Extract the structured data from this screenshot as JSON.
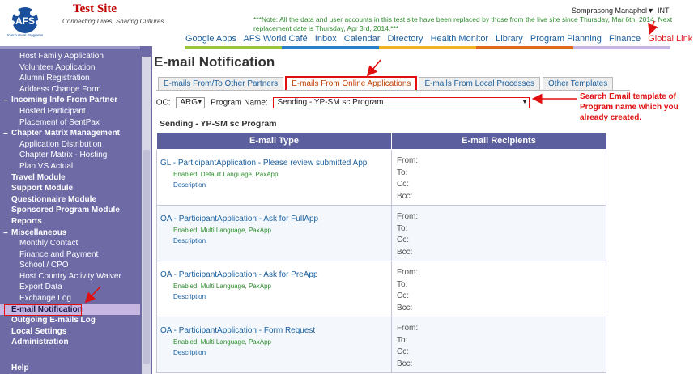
{
  "header": {
    "logo_text": "AFS",
    "logo_subtext": "Intercultural Programs",
    "site_title": "Test Site",
    "tagline": "Connecting Lives, Sharing Cultures",
    "user_name": "Somprasong Manaphol▼",
    "user_region": "INT",
    "notice": "***Note: All the data and user accounts in this test site have been replaced by those from the live site since Thursday, Mar 6th, 2014. Next replacement date is Thursday, Apr 3rd, 2014.***"
  },
  "topnav": [
    "Google Apps",
    "AFS World Café",
    "Inbox",
    "Calendar",
    "Directory",
    "Health Monitor",
    "Library",
    "Program Planning",
    "Finance",
    "Global Link",
    "Lo"
  ],
  "colors": {
    "sidebar_bg": "#6d6aa6",
    "table_header": "#5b5f9e",
    "link_blue": "#1a5f9e",
    "annotation_red": "#e01010",
    "meta_green": "#2e8b2e",
    "colorbar": [
      "#9bc53d",
      "#2b7fc4",
      "#f0b323",
      "#e06a1a",
      "#c8b6e2"
    ]
  },
  "sidebar": {
    "items": [
      {
        "label": "Host Family Application",
        "type": "sub"
      },
      {
        "label": "Volunteer Application",
        "type": "sub"
      },
      {
        "label": "Alumni Registration",
        "type": "sub"
      },
      {
        "label": "Address Change Form",
        "type": "sub"
      },
      {
        "label": "Incoming Info From Partner",
        "type": "head",
        "expand": "−"
      },
      {
        "label": "Hosted Participant",
        "type": "sub"
      },
      {
        "label": "Placement of SentPax",
        "type": "sub"
      },
      {
        "label": "Chapter Matrix Management",
        "type": "head",
        "expand": "−"
      },
      {
        "label": "Application Distribution",
        "type": "sub"
      },
      {
        "label": "Chapter Matrix - Hosting",
        "type": "sub"
      },
      {
        "label": "Plan VS Actual",
        "type": "sub"
      },
      {
        "label": "Travel Module",
        "type": "head"
      },
      {
        "label": "Support Module",
        "type": "head"
      },
      {
        "label": "Questionnaire Module",
        "type": "head"
      },
      {
        "label": "Sponsored Program Module",
        "type": "head"
      },
      {
        "label": "Reports",
        "type": "head"
      },
      {
        "label": "Miscellaneous",
        "type": "head",
        "expand": "−"
      },
      {
        "label": "Monthly Contact",
        "type": "sub"
      },
      {
        "label": "Finance and Payment",
        "type": "sub"
      },
      {
        "label": "School / CPO",
        "type": "sub"
      },
      {
        "label": "Host Country Activity Waiver",
        "type": "sub"
      },
      {
        "label": "Export Data",
        "type": "sub"
      },
      {
        "label": "Exchange Log",
        "type": "sub"
      },
      {
        "label": "E-mail Notification",
        "type": "head",
        "active": true
      },
      {
        "label": "Outgoing E-mails Log",
        "type": "head"
      },
      {
        "label": "Local Settings",
        "type": "head"
      },
      {
        "label": "Administration",
        "type": "head"
      }
    ],
    "help": "Help"
  },
  "main": {
    "title": "E-mail Notification",
    "tabs": [
      {
        "label": "E-mails From/To Other Partners",
        "active": false
      },
      {
        "label": "E-mails From Online Applications",
        "active": true
      },
      {
        "label": "E-mails From Local Processes",
        "active": false
      },
      {
        "label": "Other Templates",
        "active": false
      }
    ],
    "filter": {
      "ioc_label": "IOC:",
      "ioc_value": "ARG",
      "program_label": "Program Name:",
      "program_value": "Sending - YP-SM sc Program"
    },
    "annotation": "Search Email template of Program name which you already created.",
    "program_heading": "Sending - YP-SM sc Program",
    "table": {
      "headers": [
        "E-mail Type",
        "E-mail Recipients"
      ],
      "recipient_labels": [
        "From:",
        "To:",
        "Cc:",
        "Bcc:"
      ],
      "rows": [
        {
          "name": "GL - ParticipantApplication - Please review submitted App",
          "meta": "Enabled, Default Language, PaxApp",
          "desc": "Description"
        },
        {
          "name": "OA - ParticipantApplication - Ask for FullApp",
          "meta": "Enabled, Multi Language, PaxApp",
          "desc": "Description"
        },
        {
          "name": "OA - ParticipantApplication - Ask for PreApp",
          "meta": "Enabled, Multi Language, PaxApp",
          "desc": "Description"
        },
        {
          "name": "OA - ParticipantApplication - Form Request",
          "meta": "Enabled, Multi Language, PaxApp",
          "desc": "Description"
        }
      ]
    }
  }
}
